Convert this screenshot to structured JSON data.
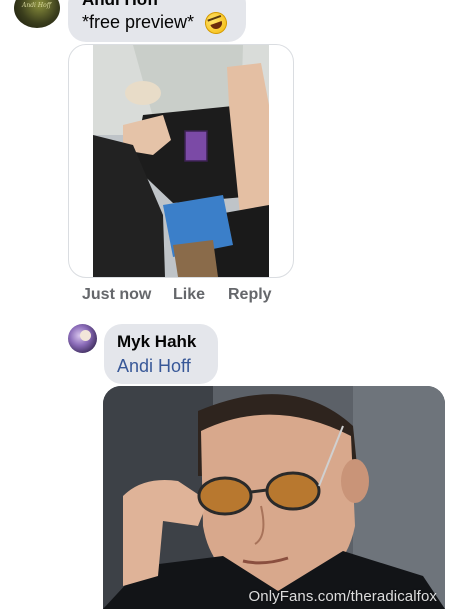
{
  "comment_1": {
    "author": "Andi Hoff",
    "text": "*free preview*",
    "emoji": "rolling-on-floor-laughing",
    "avatar_text": "Andi Hoff"
  },
  "actions": {
    "time": "Just now",
    "like": "Like",
    "reply": "Reply"
  },
  "comment_2": {
    "author": "Myk Hahk",
    "mention": "Andi Hoff"
  },
  "watermark": "OnlyFans.com/theradicalfox",
  "colors": {
    "bubble": "#e4e6eb",
    "action_text": "#65676b",
    "mention": "#385898"
  }
}
